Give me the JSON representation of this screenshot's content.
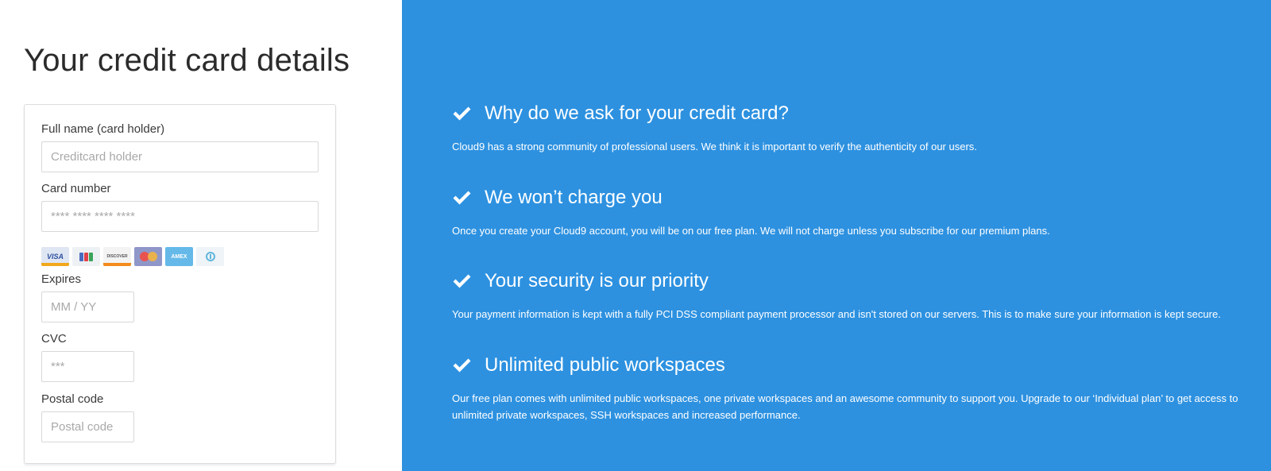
{
  "page_title": "Your credit card details",
  "form": {
    "holder": {
      "label": "Full name (card holder)",
      "placeholder": "Creditcard holder"
    },
    "card_number": {
      "label": "Card number",
      "placeholder": "**** **** **** ****"
    },
    "card_brands": [
      "VISA",
      "JCB",
      "DISCOVER",
      "MasterCard",
      "AMEX",
      "Diners Club"
    ],
    "card_logo_text": {
      "visa": "VISA",
      "discover": "DISCOVER",
      "amex": "AMEX"
    },
    "expires": {
      "label": "Expires",
      "placeholder": "MM / YY"
    },
    "cvc": {
      "label": "CVC",
      "placeholder": "***"
    },
    "postal": {
      "label": "Postal code",
      "placeholder": "Postal code"
    }
  },
  "benefits": [
    {
      "icon": "check-icon",
      "title": "Why do we ask for your credit card?",
      "text": "Cloud9 has a strong community of professional users. We think it is important to verify the authenticity of our users."
    },
    {
      "icon": "check-icon",
      "title": "We won’t charge you",
      "text": "Once you create your Cloud9 account, you will be on our free plan. We will not charge unless you subscribe for our premium plans."
    },
    {
      "icon": "check-icon",
      "title": "Your security is our priority",
      "text": "Your payment information is kept with a fully PCI DSS compliant payment processor and isn't stored on our servers. This is to make sure your information is kept secure."
    },
    {
      "icon": "check-icon",
      "title": "Unlimited public workspaces",
      "text": "Our free plan comes with unlimited public workspaces, one private workspaces and an awesome community to support you. Upgrade to our ‘Individual plan’ to get access to unlimited private workspaces, SSH workspaces and increased performance."
    }
  ],
  "colors": {
    "accent_panel": "#2d91e0",
    "text_on_accent": "#ffffff",
    "title_text": "#2b2b2b",
    "input_border": "#d8d8d8"
  }
}
